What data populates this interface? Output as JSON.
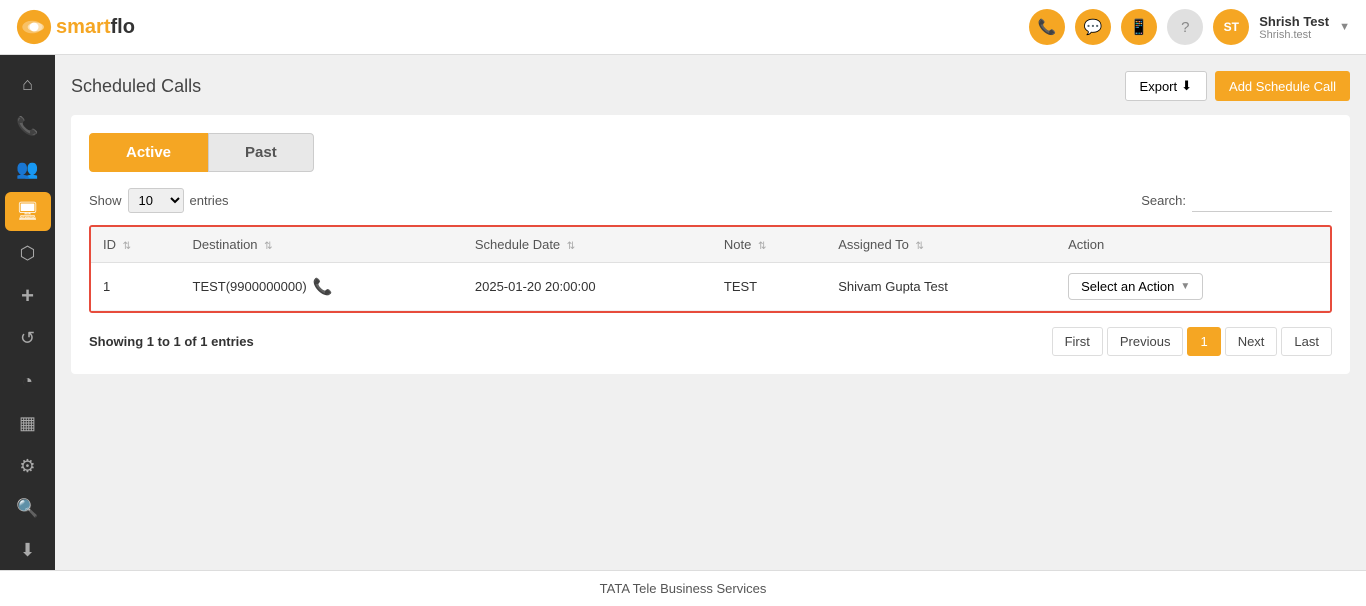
{
  "header": {
    "logo_text": "smartflo",
    "user_name": "Shrish Test",
    "user_sub": "Shrish.test",
    "user_initials": "ST",
    "icons": [
      {
        "name": "phone-icon",
        "symbol": "📞"
      },
      {
        "name": "sms-icon",
        "symbol": "💬"
      },
      {
        "name": "call-icon",
        "symbol": "📱"
      },
      {
        "name": "help-icon",
        "symbol": "?"
      }
    ]
  },
  "sidebar": {
    "items": [
      {
        "name": "home-icon",
        "symbol": "⌂",
        "active": false
      },
      {
        "name": "calls-icon",
        "symbol": "📞",
        "active": false
      },
      {
        "name": "contacts-icon",
        "symbol": "👥",
        "active": false
      },
      {
        "name": "monitor-icon",
        "symbol": "🖥",
        "active": true
      },
      {
        "name": "network-icon",
        "symbol": "⬡",
        "active": false
      },
      {
        "name": "plus-icon",
        "symbol": "+",
        "active": false
      },
      {
        "name": "refresh-icon",
        "symbol": "↺",
        "active": false
      },
      {
        "name": "chart-icon",
        "symbol": "◔",
        "active": false
      },
      {
        "name": "bar-icon",
        "symbol": "▦",
        "active": false
      },
      {
        "name": "gear-icon",
        "symbol": "⚙",
        "active": false
      },
      {
        "name": "search-icon",
        "symbol": "🔍",
        "active": false
      },
      {
        "name": "download-icon",
        "symbol": "⬇",
        "active": false
      }
    ]
  },
  "page": {
    "title": "Scheduled Calls",
    "export_label": "Export",
    "add_schedule_label": "Add Schedule Call"
  },
  "tabs": [
    {
      "label": "Active",
      "active": true
    },
    {
      "label": "Past",
      "active": false
    }
  ],
  "show_entries": {
    "label_show": "Show",
    "value": "10",
    "label_entries": "entries",
    "search_label": "Search:"
  },
  "table": {
    "columns": [
      {
        "label": "ID",
        "key": "id"
      },
      {
        "label": "Destination",
        "key": "destination"
      },
      {
        "label": "Schedule Date",
        "key": "schedule_date"
      },
      {
        "label": "Note",
        "key": "note"
      },
      {
        "label": "Assigned To",
        "key": "assigned_to"
      },
      {
        "label": "Action",
        "key": "action"
      }
    ],
    "rows": [
      {
        "id": "1",
        "destination": "TEST(9900000000)",
        "schedule_date": "2025-01-20 20:00:00",
        "note": "TEST",
        "assigned_to": "Shivam Gupta Test",
        "action_label": "Select an Action"
      }
    ]
  },
  "pagination": {
    "showing_text": "Showing",
    "showing_range": "1 to 1 of 1",
    "showing_entries": "entries",
    "first_label": "First",
    "prev_label": "Previous",
    "current_page": "1",
    "next_label": "Next",
    "last_label": "Last"
  },
  "footer": {
    "text": "TATA Tele Business Services"
  }
}
